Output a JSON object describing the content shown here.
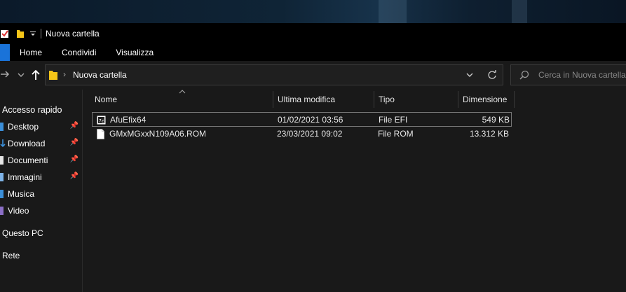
{
  "window": {
    "title": "Nuova cartella"
  },
  "ribbon": {
    "tabs": [
      "Home",
      "Condividi",
      "Visualizza"
    ]
  },
  "address": {
    "current": "Nuova cartella",
    "search_placeholder": "Cerca in Nuova cartella"
  },
  "sidebar": {
    "items": [
      {
        "label": "Accesso rapido",
        "pinned": false
      },
      {
        "label": "Desktop",
        "pinned": true
      },
      {
        "label": "Download",
        "pinned": true
      },
      {
        "label": "Documenti",
        "pinned": true
      },
      {
        "label": "Immagini",
        "pinned": true
      },
      {
        "label": "Musica",
        "pinned": false
      },
      {
        "label": "Video",
        "pinned": false
      },
      {
        "label": "Questo PC",
        "pinned": false
      },
      {
        "label": "Rete",
        "pinned": false
      }
    ]
  },
  "columns": {
    "name": "Nome",
    "modified": "Ultima modifica",
    "type": "Tipo",
    "size": "Dimensione"
  },
  "files": [
    {
      "name": "AfuEfix64",
      "modified": "01/02/2021 03:56",
      "type": "File EFI",
      "size": "549 KB",
      "icon": "efi-file-icon"
    },
    {
      "name": "GMxMGxxN109A06.ROM",
      "modified": "23/03/2021 09:02",
      "type": "File ROM",
      "size": "13.312 KB",
      "icon": "rom-file-icon"
    }
  ],
  "colors": {
    "accent": "#1a73d9",
    "folder": "#f5c518",
    "background": "#191919"
  }
}
